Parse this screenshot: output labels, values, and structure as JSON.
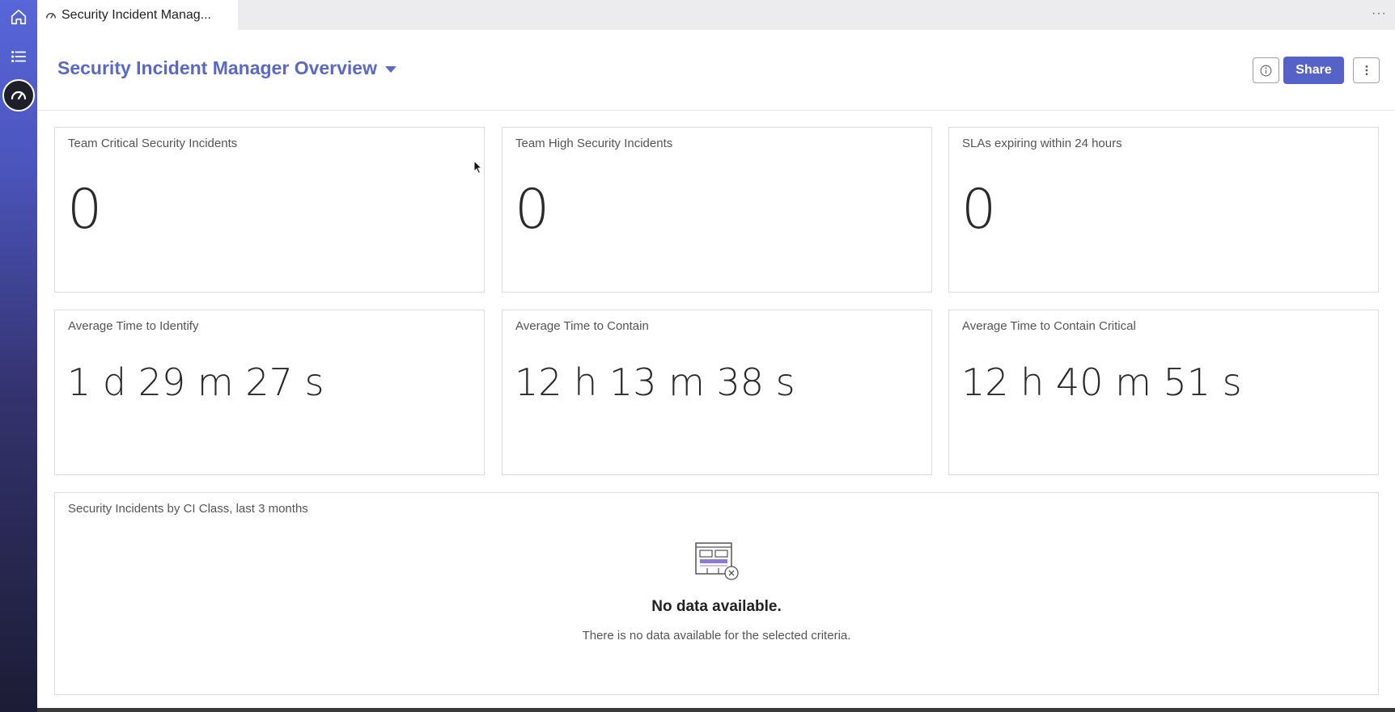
{
  "tab": {
    "label": "Security Incident Manag..."
  },
  "header": {
    "title": "Security Incident Manager Overview",
    "share_label": "Share"
  },
  "metrics": [
    {
      "title": "Team Critical Security Incidents",
      "value": "0"
    },
    {
      "title": "Team High Security Incidents",
      "value": "0"
    },
    {
      "title": "SLAs expiring within 24 hours",
      "value": "0"
    },
    {
      "title": "Average Time to Identify",
      "value": "1 d 29 m 27 s"
    },
    {
      "title": "Average Time to Contain",
      "value": "12 h 13 m 38 s"
    },
    {
      "title": "Average Time to Contain Critical",
      "value": "12 h 40 m 51 s"
    }
  ],
  "chart_panel": {
    "title": "Security Incidents by CI Class, last 3 months",
    "nodata_title": "No data available.",
    "nodata_message": "There is no data available for the selected criteria."
  },
  "colors": {
    "accent": "#5563c8",
    "title": "#5a68c9"
  }
}
